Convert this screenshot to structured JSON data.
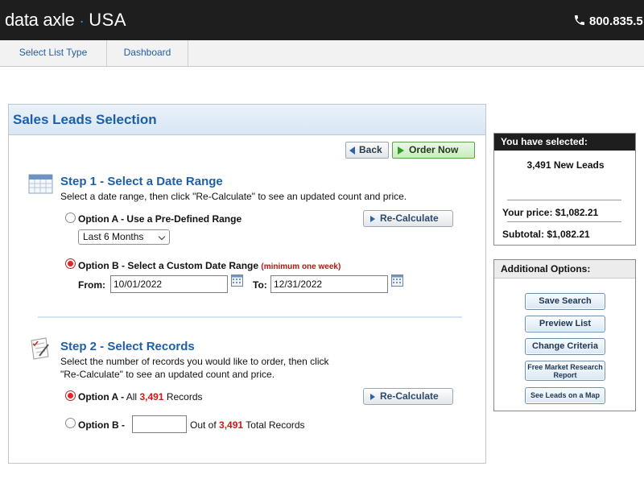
{
  "header": {
    "logo_brand": "data axle",
    "logo_country": "USA",
    "phone": "800.835.5"
  },
  "nav": {
    "items": [
      {
        "label": "Select List Type"
      },
      {
        "label": "Dashboard"
      }
    ]
  },
  "panel": {
    "title": "Sales Leads Selection",
    "back_label": "Back",
    "order_label": "Order Now"
  },
  "step1": {
    "title": "Step 1 - Select a Date Range",
    "description": "Select a date range, then click \"Re-Calculate\" to see an updated count and price.",
    "option_a_label": "Option A - Use a Pre-Defined Range",
    "option_a_checked": false,
    "range_select_value": "Last 6 Months",
    "recalc_label": "Re-Calculate",
    "option_b_label": "Option B - Select a Custom Date Range",
    "option_b_note": "(minimum one week)",
    "option_b_checked": true,
    "from_label": "From:",
    "from_value": "10/01/2022",
    "to_label": "To:",
    "to_value": "12/31/2022"
  },
  "step2": {
    "title": "Step 2 - Select Records",
    "description_line1": "Select the number of records you would like to order, then click",
    "description_line2": "\"Re-Calculate\" to see an updated count and price.",
    "option_a_prefix": "Option A -",
    "option_a_all": "All",
    "option_a_count": "3,491",
    "option_a_suffix": "Records",
    "option_a_checked": true,
    "recalc_label": "Re-Calculate",
    "option_b_prefix": "Option B -",
    "option_b_value": "",
    "option_b_outof": "Out of",
    "option_b_count": "3,491",
    "option_b_suffix": "Total Records",
    "option_b_checked": false
  },
  "selected": {
    "header": "You have selected:",
    "leads": "3,491 New Leads",
    "price": "Your price: $1,082.21",
    "subtotal": "Subtotal: $1,082.21"
  },
  "additional": {
    "header": "Additional Options:",
    "buttons": [
      {
        "label": "Save Search"
      },
      {
        "label": "Preview List"
      },
      {
        "label": "Change Criteria"
      },
      {
        "label": "Free Market Research Report"
      },
      {
        "label": "See Leads on a Map"
      }
    ]
  },
  "colors": {
    "brand_blue": "#1d5fa8",
    "accent_red": "#d01818",
    "header_dark": "#1e1e1e",
    "order_green": "#2f9a25"
  }
}
